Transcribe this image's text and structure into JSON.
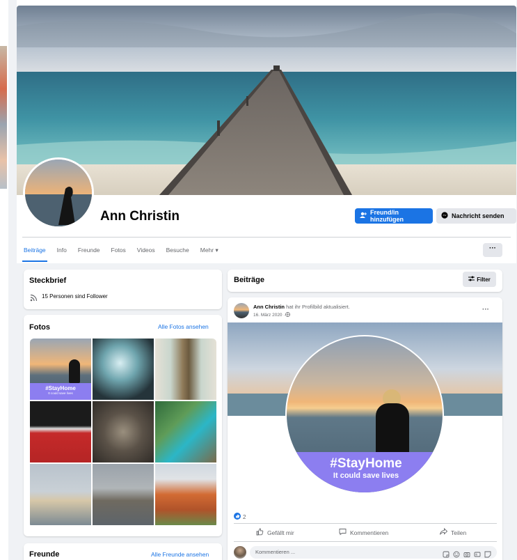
{
  "profile": {
    "name": "Ann Christin",
    "add_friend_label": "Freund/in hinzufügen",
    "message_label": "Nachricht senden",
    "more_dots": "···"
  },
  "tabs": [
    {
      "label": "Beiträge"
    },
    {
      "label": "Info"
    },
    {
      "label": "Freunde"
    },
    {
      "label": "Fotos"
    },
    {
      "label": "Videos"
    },
    {
      "label": "Besuche"
    },
    {
      "label": "Mehr ▾"
    }
  ],
  "steckbrief": {
    "title": "Steckbrief",
    "followers": "15 Personen sind Follower"
  },
  "photos": {
    "title": "Fotos",
    "see_all": "Alle Fotos ansehen",
    "overlay_title": "#StayHome",
    "overlay_sub": "It could save lives"
  },
  "friends": {
    "title": "Freunde",
    "see_all": "Alle Freunde ansehen"
  },
  "posts_header": {
    "title": "Beiträge",
    "filter_label": "Filter"
  },
  "post": {
    "author": "Ann Christin",
    "action": " hat ihr Profilbild aktualisiert.",
    "date": "16. März 2020 · ",
    "more": "···",
    "image_title": "#StayHome",
    "image_sub": "It could save lives",
    "reaction_count": "2",
    "like_label": "Gefällt mir",
    "comment_label": "Kommentieren",
    "share_label": "Teilen",
    "comment_placeholder": "Kommentieren ..."
  },
  "colors": {
    "accent": "#1b74e4",
    "stayhome_purple": "#8c7ef0"
  }
}
